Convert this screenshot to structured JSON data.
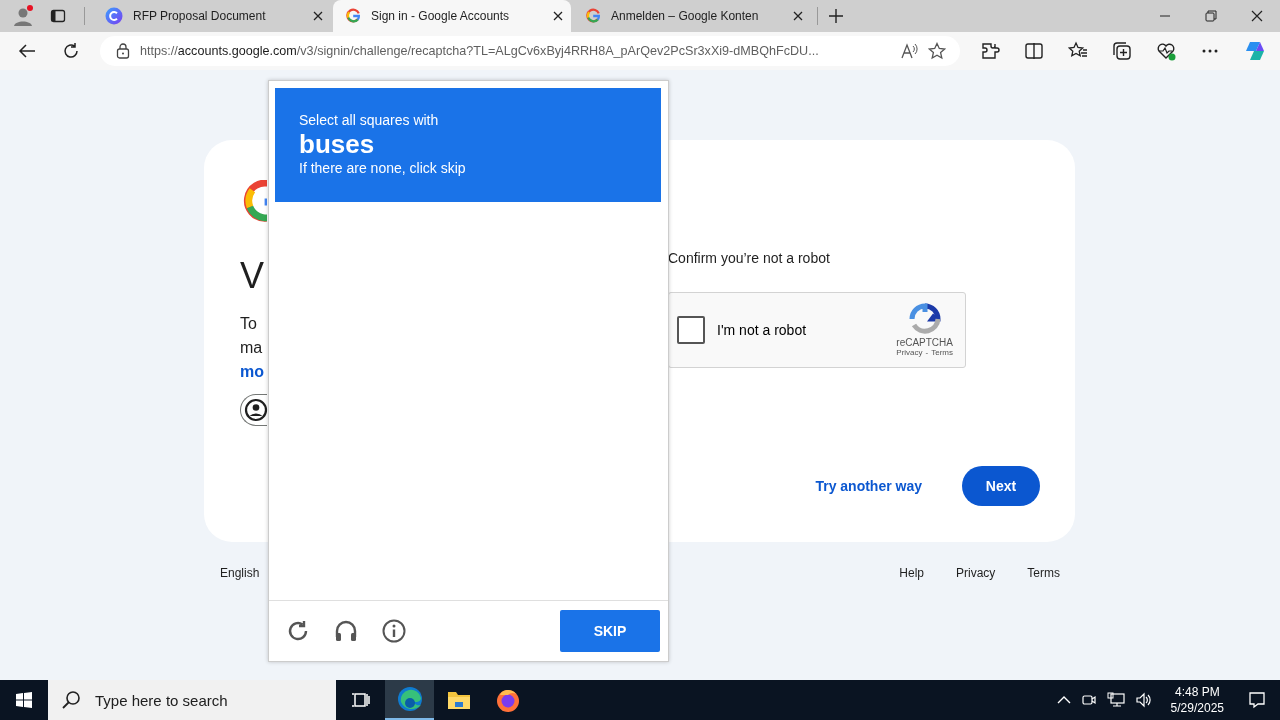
{
  "browser": {
    "tabs": [
      {
        "title": "RFP Proposal Document",
        "kind": "copilot",
        "selected": false
      },
      {
        "title": "Sign in - Google Accounts",
        "kind": "google",
        "selected": true
      },
      {
        "title": "Anmelden – Google Konten",
        "kind": "google",
        "selected": false
      }
    ],
    "address": {
      "scheme": "https://",
      "host": "accounts.google.com",
      "path": "/v3/signin/challenge/recaptcha?TL=ALgCv6xByj4RRH8A_pArQev2PcSr3xXi9-dMBQhFcDU..."
    }
  },
  "signin": {
    "heading": "V",
    "body_lines": [
      "To",
      "ma"
    ],
    "link": "mo",
    "confirm_label": "Confirm you’re not a robot",
    "recaptcha": {
      "label": "I'm not a robot",
      "checked": false,
      "brand": "reCAPTCHA",
      "privacy": "Privacy",
      "separator": "-",
      "terms": "Terms"
    },
    "secondary_button": "Try another way",
    "primary_button": "Next"
  },
  "footer": {
    "language": "English",
    "links": [
      "Help",
      "Privacy",
      "Terms"
    ]
  },
  "captcha": {
    "prompt": "Select all squares with",
    "target": "buses",
    "hint": "If there are none, click skip",
    "button": "SKIP"
  },
  "taskbar": {
    "search_placeholder": "Type here to search",
    "apps": [
      {
        "kind": "task-view",
        "selected": false
      },
      {
        "kind": "edge",
        "selected": true
      },
      {
        "kind": "explorer",
        "selected": false
      },
      {
        "kind": "firefox",
        "selected": false
      }
    ],
    "time": "4:48 PM",
    "date": "5/29/2025"
  }
}
